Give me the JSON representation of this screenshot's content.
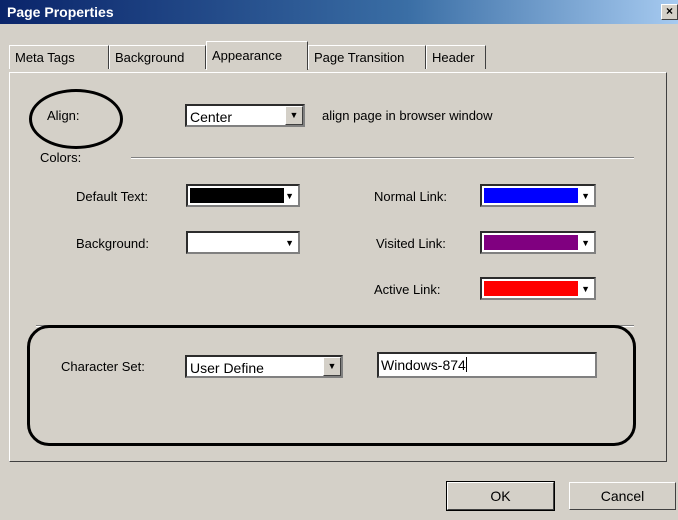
{
  "window": {
    "title": "Page Properties",
    "close_glyph": "×"
  },
  "tabs": [
    {
      "label": "Meta Tags"
    },
    {
      "label": "Background"
    },
    {
      "label": "Appearance",
      "active": true
    },
    {
      "label": "Page Transition"
    },
    {
      "label": "Header"
    }
  ],
  "align": {
    "label": "Align:",
    "value": "Center",
    "hint": "align page in browser window"
  },
  "colors": {
    "section_label": "Colors:",
    "default_text": {
      "label": "Default Text:",
      "color": "#000000"
    },
    "background": {
      "label": "Background:",
      "color": "#ffffff"
    },
    "normal_link": {
      "label": "Normal Link:",
      "color": "#0000ff"
    },
    "visited_link": {
      "label": "Visited Link:",
      "color": "#800080"
    },
    "active_link": {
      "label": "Active Link:",
      "color": "#ff0000"
    }
  },
  "charset": {
    "label": "Character Set:",
    "select_value": "User Define",
    "text_value": "Windows-874"
  },
  "buttons": {
    "ok": "OK",
    "cancel": "Cancel"
  },
  "icons": {
    "dropdown": "triangle-down",
    "close": "x-mark"
  }
}
